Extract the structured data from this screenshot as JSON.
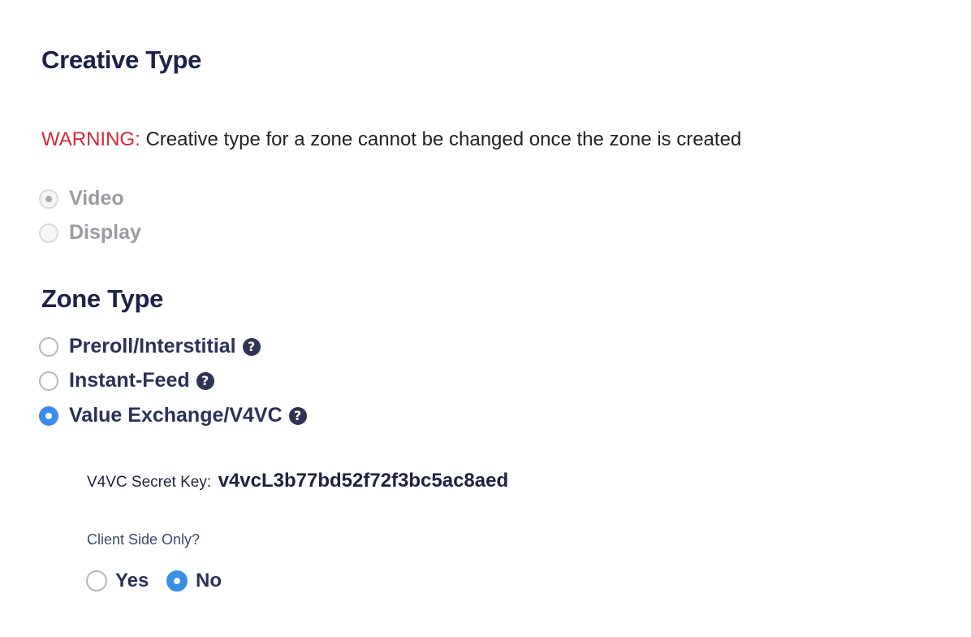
{
  "creative_type": {
    "heading": "Creative Type",
    "warning_label": "WARNING:",
    "warning_text": " Creative type for a zone cannot be changed once the zone is created",
    "options": [
      {
        "label": "Video",
        "selected": true,
        "disabled": true
      },
      {
        "label": "Display",
        "selected": false,
        "disabled": true
      }
    ]
  },
  "zone_type": {
    "heading": "Zone Type",
    "options": [
      {
        "label": "Preroll/Interstitial",
        "selected": false,
        "help_icon": "question-circle-icon"
      },
      {
        "label": "Instant-Feed",
        "selected": false,
        "help_icon": "question-circle-icon"
      },
      {
        "label": "Value Exchange/V4VC",
        "selected": true,
        "help_icon": "question-circle-icon"
      }
    ]
  },
  "v4vc": {
    "secret_label": "V4VC Secret Key:",
    "secret_value": "v4vcL3b77bd52f72f3bc5ac8aed",
    "client_side_label": "Client Side Only?",
    "client_side_options": [
      {
        "label": "Yes",
        "selected": false
      },
      {
        "label": "No",
        "selected": true
      }
    ]
  },
  "colors": {
    "heading": "#1c2148",
    "warning": "#d9263b",
    "accent": "#3a8ee6",
    "disabled_text": "#9a9ca3"
  }
}
